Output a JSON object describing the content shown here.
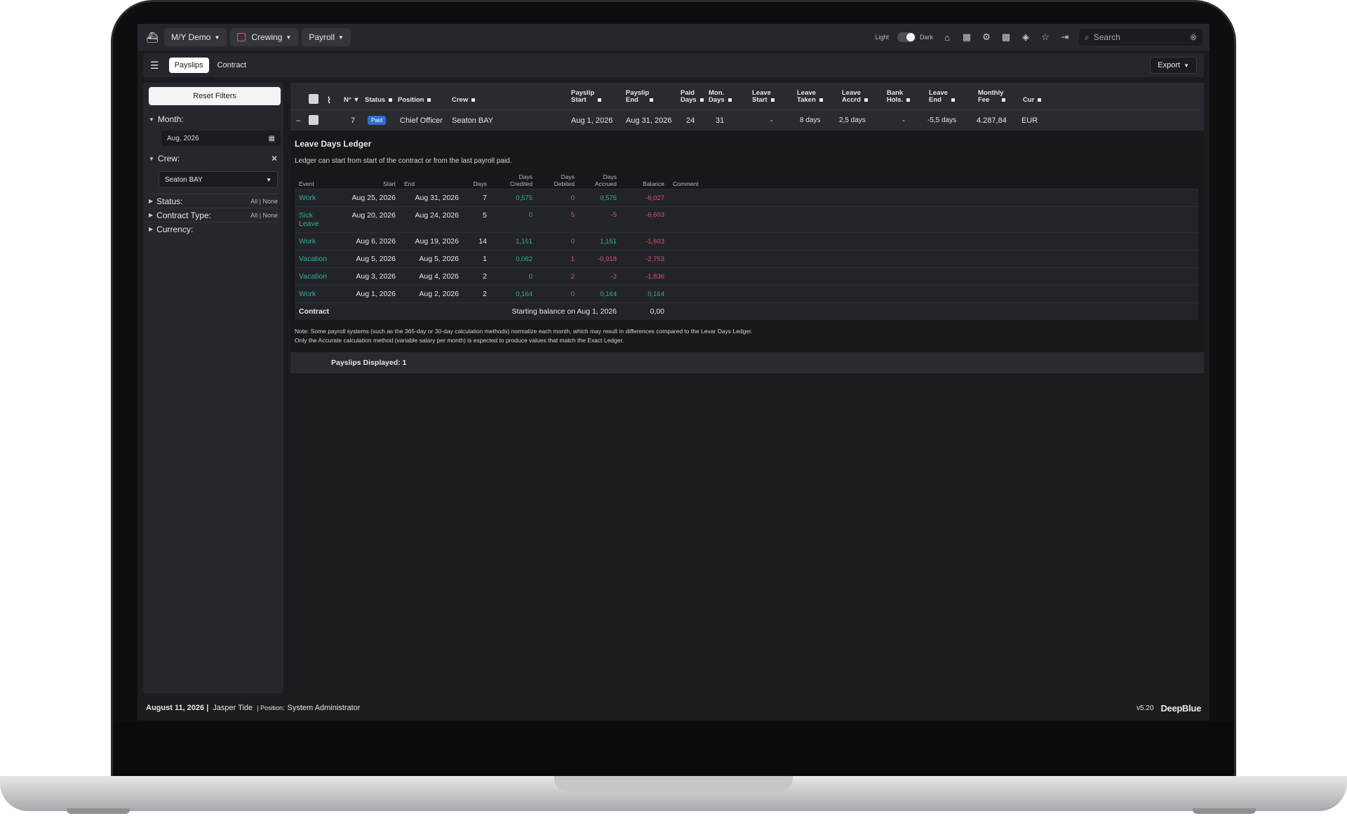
{
  "topbar": {
    "vessel": "M/Y Demo",
    "module": "Crewing",
    "submodule": "Payroll",
    "theme_light": "Light",
    "theme_dark": "Dark",
    "search_placeholder": "Search"
  },
  "subbar": {
    "tabs": [
      "Payslips",
      "Contract"
    ],
    "export": "Export"
  },
  "sidebar": {
    "reset": "Reset Filters",
    "month_label": "Month:",
    "month_value": "Aug, 2026",
    "crew_label": "Crew:",
    "crew_value": "Seaton BAY",
    "status_label": "Status:",
    "contract_type_label": "Contract Type:",
    "currency_label": "Currency:",
    "all_none": "All | None"
  },
  "table": {
    "headers": {
      "no": "N°",
      "status": "Status",
      "position": "Position",
      "crew": "Crew",
      "payslip_start_1": "Payslip",
      "payslip_start_2": "Start",
      "payslip_end_1": "Payslip",
      "payslip_end_2": "End",
      "paid_days_1": "Paid",
      "paid_days_2": "Days",
      "mon_days_1": "Mon.",
      "mon_days_2": "Days",
      "leave_start_1": "Leave",
      "leave_start_2": "Start",
      "leave_taken_1": "Leave",
      "leave_taken_2": "Taken",
      "leave_accrd_1": "Leave",
      "leave_accrd_2": "Accrd",
      "bank_hols_1": "Bank",
      "bank_hols_2": "Hols.",
      "leave_end_1": "Leave",
      "leave_end_2": "End",
      "monthly_fee_1": "Monthly",
      "monthly_fee_2": "Fee",
      "cur": "Cur"
    },
    "row": {
      "toggle": "–",
      "no": "7",
      "status": "Paid",
      "position": "Chief Officer",
      "crew": "Seaton BAY",
      "start": "Aug 1, 2026",
      "end": "Aug 31, 2026",
      "paid_days": "24",
      "mon_days": "31",
      "leave_start": "-",
      "leave_taken": "8 days",
      "leave_accrd": "2,5 days",
      "bank_hols": "-",
      "leave_end": "-5,5 days",
      "fee": "4.287,84",
      "cur": "EUR"
    }
  },
  "ledger": {
    "title": "Leave Days Ledger",
    "subtitle": "Ledger can start from start of the contract or from the last payroll paid.",
    "cols": {
      "event": "Event",
      "start": "Start",
      "end": "End",
      "days": "Days",
      "credited_1": "Days",
      "credited_2": "Credited",
      "debited_1": "Days",
      "debited_2": "Debited",
      "accrued_1": "Days",
      "accrued_2": "Accrued",
      "balance": "Balance",
      "comment": "Comment"
    },
    "rows": [
      {
        "event": "Work",
        "start": "Aug 25, 2026",
        "end": "Aug 31, 2026",
        "days": "7",
        "credited": "0,575",
        "debited": "0",
        "accrued": "0,575",
        "balance": "-6,027"
      },
      {
        "event": "Sick Leave",
        "start": "Aug 20, 2026",
        "end": "Aug 24, 2026",
        "days": "5",
        "credited": "0",
        "debited": "5",
        "accrued": "-5",
        "balance": "-6,603"
      },
      {
        "event": "Work",
        "start": "Aug 6, 2026",
        "end": "Aug 19, 2026",
        "days": "14",
        "credited": "1,151",
        "debited": "0",
        "accrued": "1,151",
        "balance": "-1,603"
      },
      {
        "event": "Vacation",
        "start": "Aug 5, 2026",
        "end": "Aug 5, 2026",
        "days": "1",
        "credited": "0,082",
        "debited": "1",
        "accrued": "-0,918",
        "balance": "-2,753"
      },
      {
        "event": "Vacation",
        "start": "Aug 3, 2026",
        "end": "Aug 4, 2026",
        "days": "2",
        "credited": "0",
        "debited": "2",
        "accrued": "-2",
        "balance": "-1,836"
      },
      {
        "event": "Work",
        "start": "Aug 1, 2026",
        "end": "Aug 2, 2026",
        "days": "2",
        "credited": "0,164",
        "debited": "0",
        "accrued": "0,164",
        "balance": "0,164"
      }
    ],
    "contract_label": "Contract",
    "contract_start": "Starting balance on Aug 1, 2026",
    "contract_balance": "0,00",
    "note_1": "Note: Some payroll systems (such as the 365-day or 30-day calculation methods) normalize each month, which may result in differences compared to the Levar Days Ledger.",
    "note_2": "Only the Accurate calculation method (variable salary per month) is expected to produce values that match the Exact Ledger."
  },
  "payslips_displayed": "Payslips Displayed: 1",
  "footer": {
    "date": "August 11, 2026 |",
    "user": "Jasper Tide",
    "position_label": "| Position:",
    "position": "System Administrator",
    "version": "v5.20",
    "brand": "DeepBlue"
  },
  "colors": {
    "green": "#2cb393",
    "red": "#e0526b",
    "badge": "#2d6fd0"
  }
}
